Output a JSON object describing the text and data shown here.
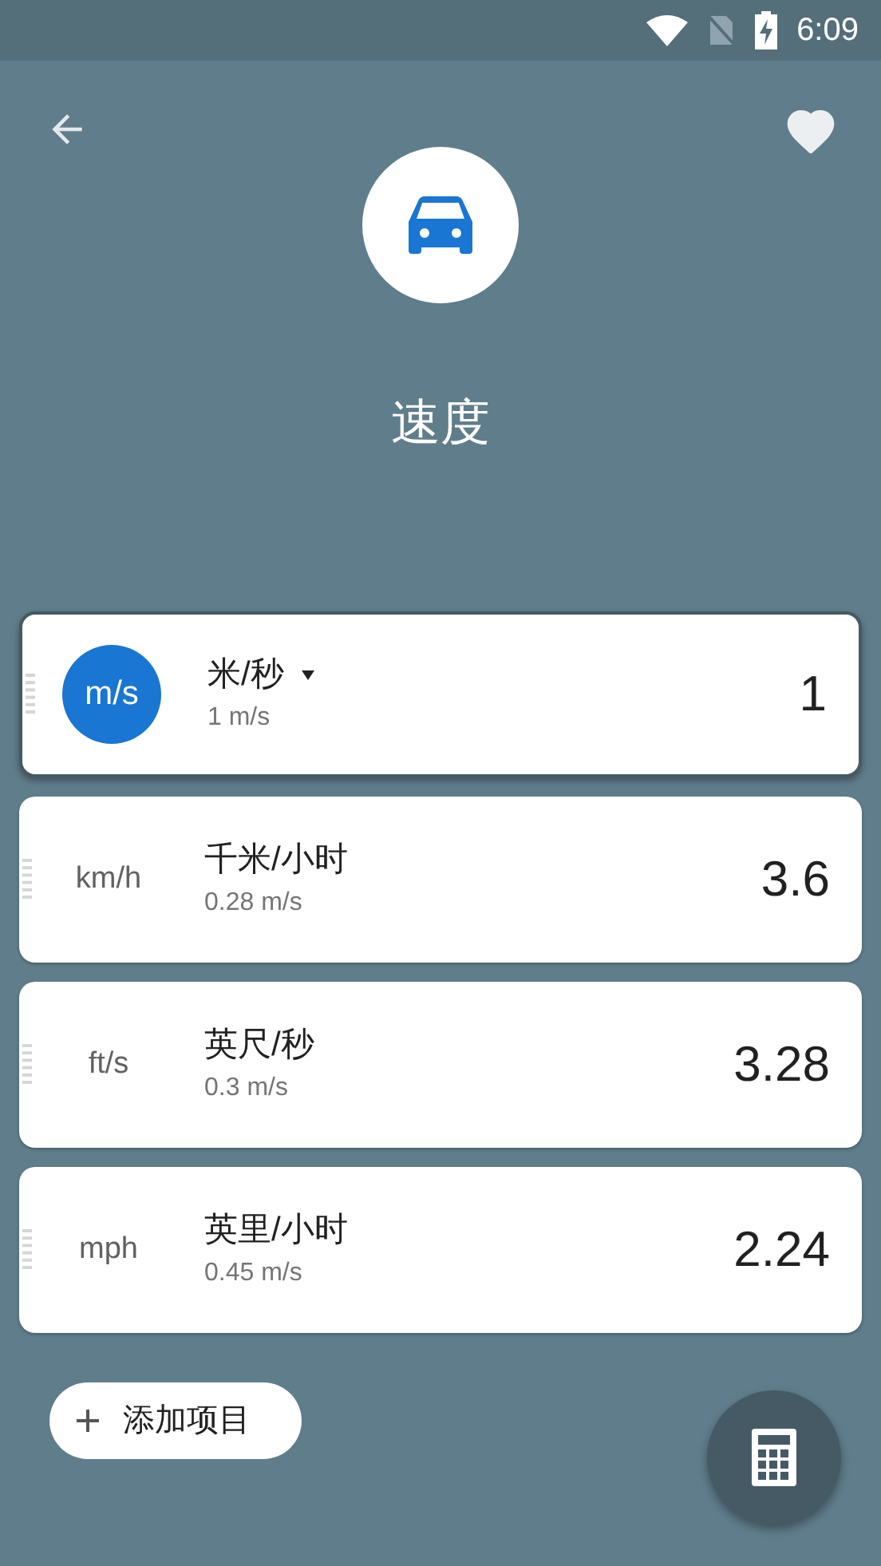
{
  "status_bar": {
    "time": "6:09"
  },
  "header": {
    "title": "速度",
    "favorite": true
  },
  "units": [
    {
      "symbol": "m/s",
      "name": "米/秒",
      "base": "1 m/s",
      "value": "1",
      "selected": true
    },
    {
      "symbol": "km/h",
      "name": "千米/小时",
      "base": "0.28 m/s",
      "value": "3.6",
      "selected": false
    },
    {
      "symbol": "ft/s",
      "name": "英尺/秒",
      "base": "0.3 m/s",
      "value": "3.28",
      "selected": false
    },
    {
      "symbol": "mph",
      "name": "英里/小时",
      "base": "0.45 m/s",
      "value": "2.24",
      "selected": false
    }
  ],
  "add_button": {
    "label": "添加项目"
  }
}
